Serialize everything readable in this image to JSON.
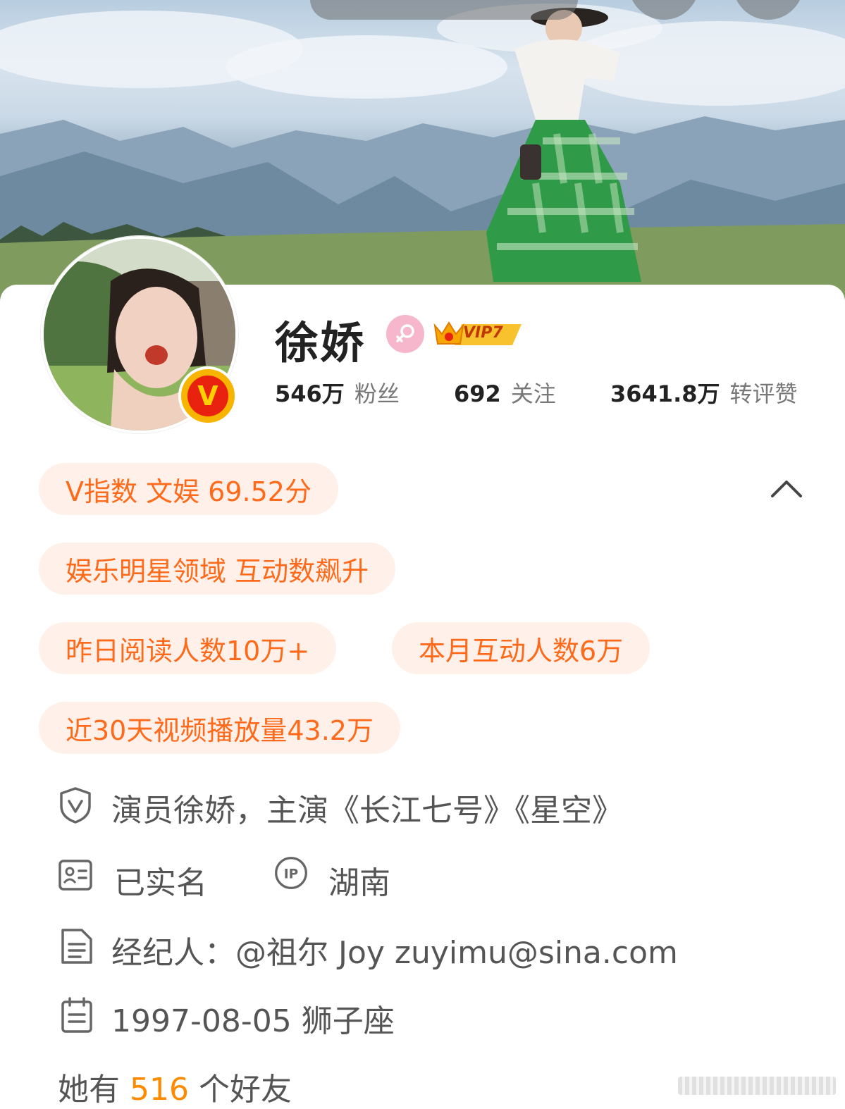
{
  "profile": {
    "name": "徐娇",
    "vip_label": "VIP7",
    "verified_badge_letter": "V",
    "stats": [
      {
        "value": "546万",
        "label": "粉丝"
      },
      {
        "value": "692",
        "label": "关注"
      },
      {
        "value": "3641.8万",
        "label": "转评赞"
      }
    ]
  },
  "tags": {
    "v_index": "V指数 文娱 69.52分",
    "field": "娱乐明星领域 互动数飙升",
    "reads_yesterday": "昨日阅读人数10万+",
    "monthly_interactions": "本月互动人数6万",
    "video_plays": "近30天视频播放量43.2万"
  },
  "info": {
    "verification": "演员徐娇，主演《长江七号》《星空》",
    "real_name": "已实名",
    "ip_location": "湖南",
    "agent": "经纪人：@祖尔 Joy  zuyimu@sina.com",
    "birthday": "1997-08-05 狮子座"
  },
  "friends": {
    "prefix": "她有",
    "count": "516",
    "suffix": "个好友"
  },
  "colors": {
    "accent": "#ff6a1a",
    "tag_bg": "#fff1ea",
    "friend_count": "#ff8a00",
    "vip_gold": "#f7b500",
    "verified_red": "#e9220f",
    "gender_pink": "#f6b6cc"
  },
  "icons": [
    "verified-shield-icon",
    "id-card-icon",
    "ip-icon",
    "document-icon",
    "calendar-icon",
    "chevron-up-icon",
    "female-icon",
    "vip-crown-icon"
  ]
}
